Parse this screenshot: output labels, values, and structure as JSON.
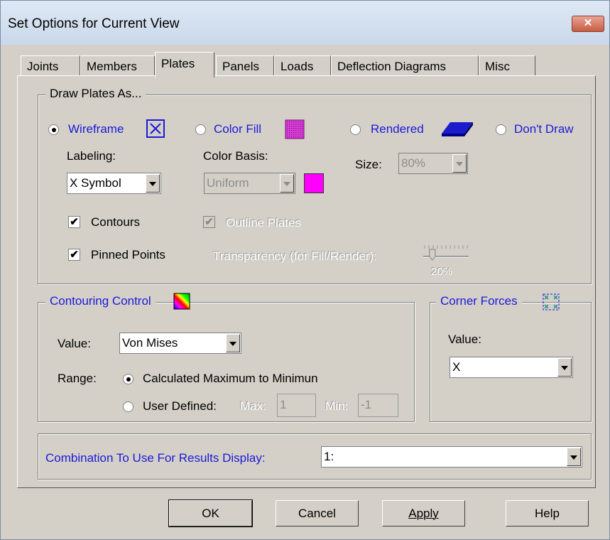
{
  "window": {
    "title": "Set Options for Current View",
    "close_label": "✕"
  },
  "tabs": [
    {
      "label": "Joints"
    },
    {
      "label": "Members"
    },
    {
      "label": "Plates"
    },
    {
      "label": "Panels"
    },
    {
      "label": "Loads"
    },
    {
      "label": "Deflection Diagrams"
    },
    {
      "label": "Misc"
    }
  ],
  "active_tab": "Plates",
  "draw_plates": {
    "title": "Draw Plates As...",
    "options": [
      {
        "label": "Wireframe",
        "selected": true
      },
      {
        "label": "Color Fill",
        "selected": false
      },
      {
        "label": "Rendered",
        "selected": false
      },
      {
        "label": "Don't Draw",
        "selected": false
      }
    ],
    "labeling_label": "Labeling:",
    "labeling_value": "X Symbol",
    "color_basis_label": "Color Basis:",
    "color_basis_value": "Uniform",
    "uniform_color": "#ff00ff",
    "size_label": "Size:",
    "size_value": "80%",
    "contours_label": "Contours",
    "contours_checked": true,
    "outline_label": "Outline Plates",
    "outline_checked": true,
    "pinned_label": "Pinned Points",
    "pinned_checked": true,
    "transparency_label": "Transparency (for Fill/Render):",
    "transparency_value": "20%",
    "transparency_level": 0.2
  },
  "contouring": {
    "title": "Contouring Control",
    "value_label": "Value:",
    "value": "Von Mises",
    "range_label": "Range:",
    "range_calc_label": "Calculated Maximum to Minimun",
    "range_user_label": "User Defined:",
    "max_label": "Max:",
    "max_value": "1",
    "min_label": "Min:",
    "min_value": "-1"
  },
  "corner_forces": {
    "title": "Corner Forces",
    "value_label": "Value:",
    "value": "X"
  },
  "combination": {
    "label": "Combination To Use For Results Display:",
    "value": "1:"
  },
  "buttons": {
    "ok": "OK",
    "cancel": "Cancel",
    "apply": "Apply",
    "help": "Help"
  },
  "colors": {
    "label_blue": "#1a1ad8",
    "dialog_face": "#d4d0c8"
  }
}
